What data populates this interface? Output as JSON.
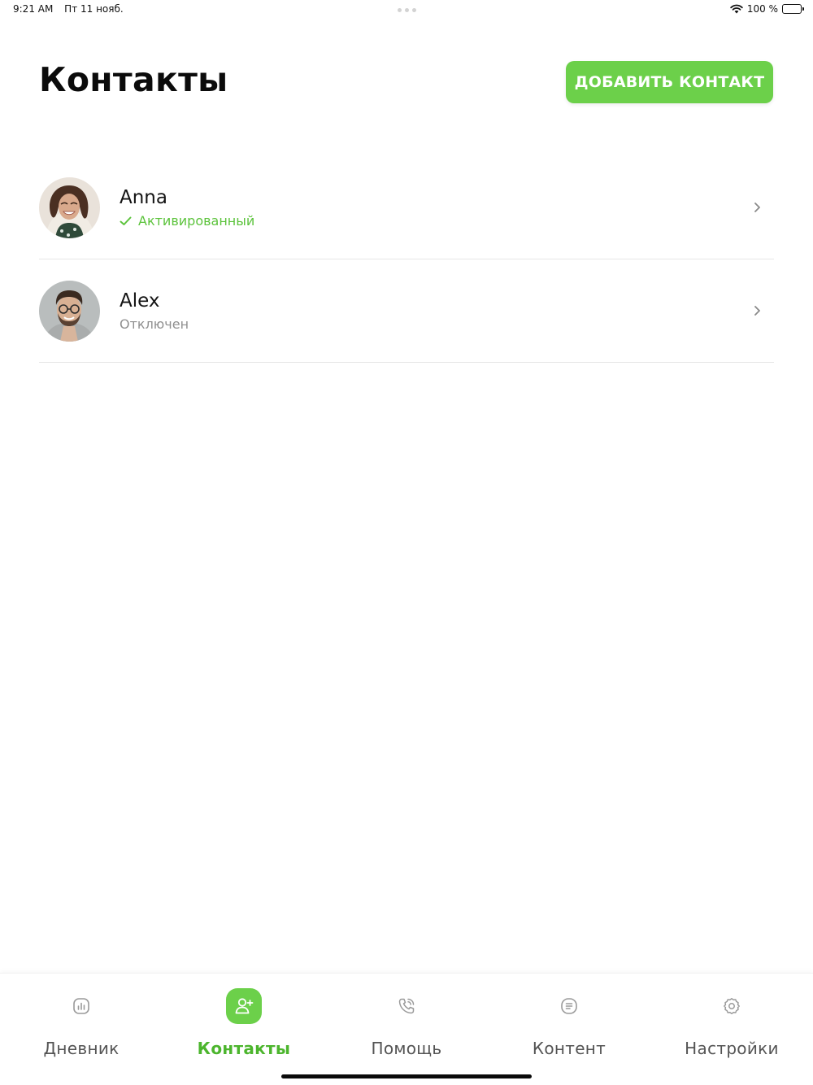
{
  "status_bar": {
    "time": "9:21 AM",
    "date": "Пт 11 нояб.",
    "battery_text": "100 %",
    "icons": [
      "wifi-icon",
      "battery-icon"
    ]
  },
  "header": {
    "title": "Контакты",
    "add_button_label": "ДОБАВИТЬ КОНТАКТ"
  },
  "contacts": [
    {
      "name": "Anna",
      "status": "Активированный",
      "status_type": "active",
      "status_icon": "check-icon",
      "status_color": "#5cc33c"
    },
    {
      "name": "Alex",
      "status": "Отключен",
      "status_type": "disabled",
      "status_color": "#8f8f8f"
    }
  ],
  "tab_bar": {
    "tabs": [
      {
        "label": "Дневник",
        "icon": "chart-icon",
        "active": false
      },
      {
        "label": "Контакты",
        "icon": "add-user-icon",
        "active": true
      },
      {
        "label": "Помощь",
        "icon": "phone-icon",
        "active": false
      },
      {
        "label": "Контент",
        "icon": "document-icon",
        "active": false
      },
      {
        "label": "Настройки",
        "icon": "gear-icon",
        "active": false
      }
    ]
  },
  "colors": {
    "accent": "#6cd04a",
    "accent_text": "#4cb52d",
    "inactive_tab": "#545454",
    "divider": "#e6e6e6"
  }
}
